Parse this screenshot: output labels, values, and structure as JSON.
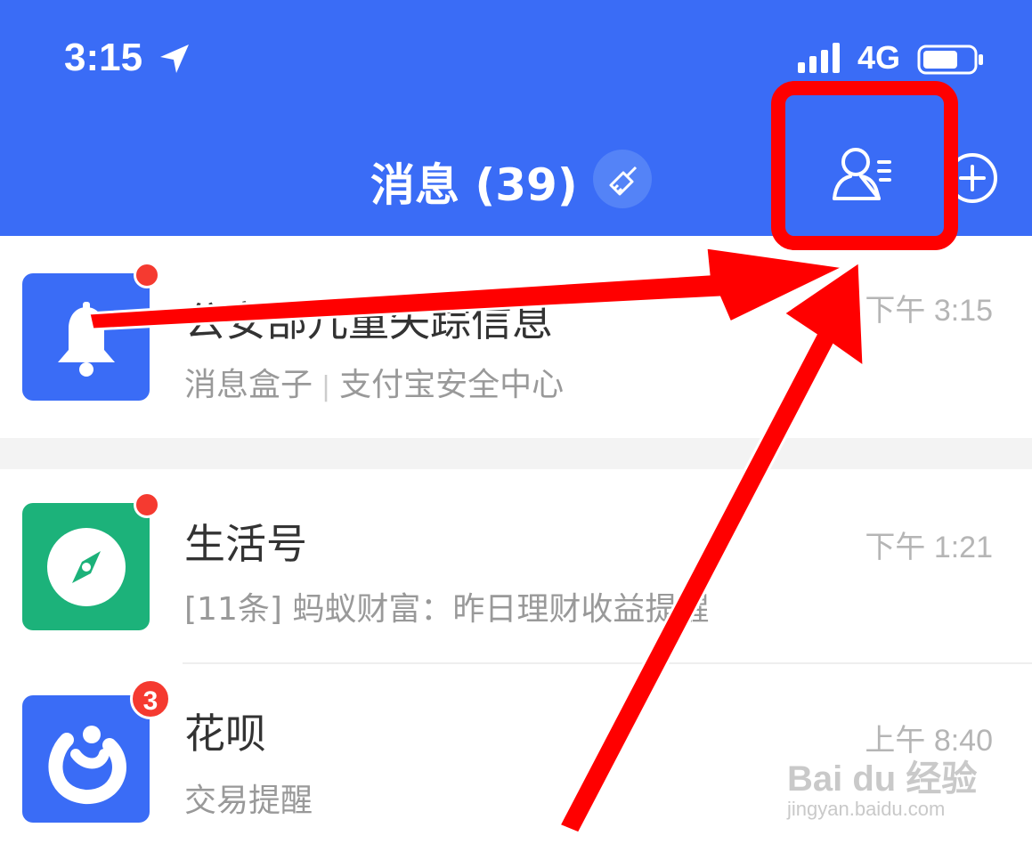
{
  "status_bar": {
    "time": "3:15",
    "network": "4G"
  },
  "header": {
    "title": "消息 (39)"
  },
  "icons": {
    "location": "location-arrow-icon",
    "signal": "signal-bars-icon",
    "battery": "battery-icon",
    "clean": "broom-icon",
    "contacts": "contacts-icon",
    "add": "plus-circle-icon",
    "bell": "bell-icon",
    "compass": "compass-icon",
    "huabei": "huabei-logo-icon"
  },
  "messages": [
    {
      "name": "公安部儿童失踪信息",
      "source": "消息盒子",
      "detail": "支付宝安全中心",
      "time": "下午 3:15",
      "avatar_color": "#3a6cf6",
      "unread_dot": true
    },
    {
      "name": "生活号",
      "detail": "[11条] 蚂蚁财富：昨日理财收益提醒",
      "time": "下午 1:21",
      "avatar_color": "#1cb27a",
      "unread_dot": true
    },
    {
      "name": "花呗",
      "detail": "交易提醒",
      "time": "上午 8:40",
      "avatar_color": "#3a6cf6",
      "badge": "3"
    }
  ],
  "watermark": {
    "brand": "Bai du 经验",
    "url": "jingyan.baidu.com"
  },
  "colors": {
    "header": "#3a6cf6",
    "annotation": "#ff0000",
    "unread": "#f53a30"
  }
}
